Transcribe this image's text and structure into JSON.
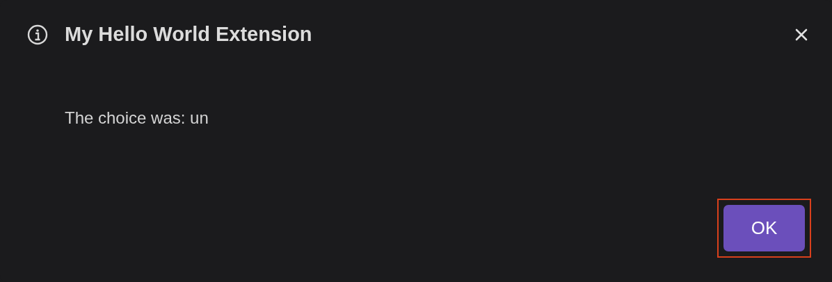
{
  "dialog": {
    "title": "My Hello World Extension",
    "message": "The choice was: un"
  },
  "buttons": [
    {
      "label": "OK",
      "highlighted": true
    }
  ]
}
